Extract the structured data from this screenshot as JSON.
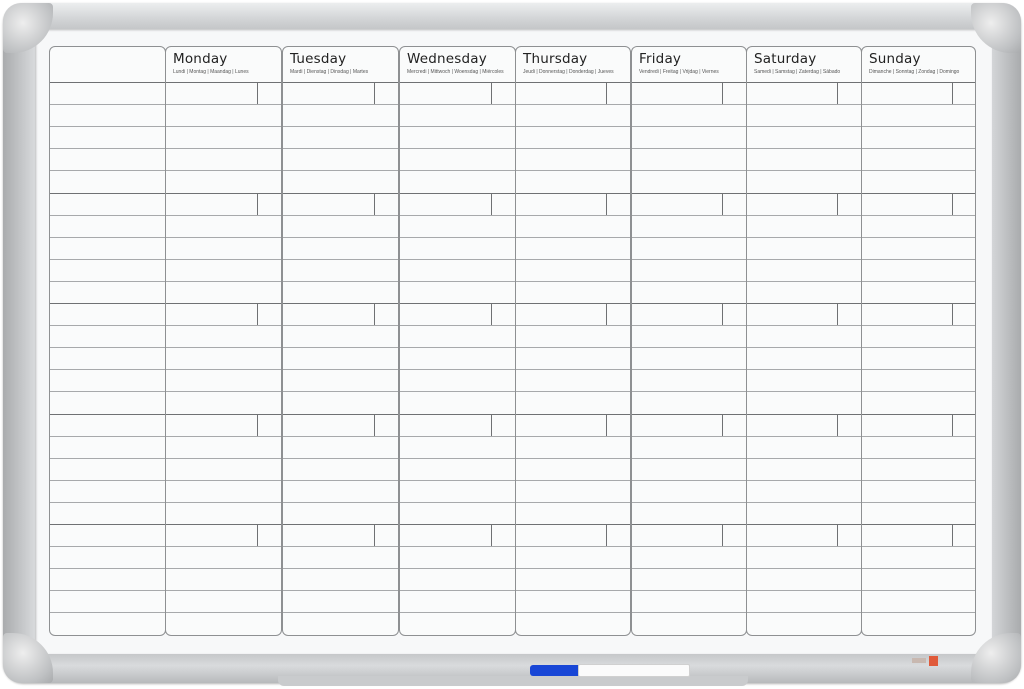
{
  "planner": {
    "days": [
      {
        "name": "Monday",
        "translations": "Lundi | Montag | Maandag | Lunes"
      },
      {
        "name": "Tuesday",
        "translations": "Mardi | Dienstag | Dinsdag | Martes"
      },
      {
        "name": "Wednesday",
        "translations": "Mercredi | Mittwoch | Woensdag | Miércoles"
      },
      {
        "name": "Thursday",
        "translations": "Jeudi | Donnerstag | Donderdag | Jueves"
      },
      {
        "name": "Friday",
        "translations": "Vendredi | Freitag | Vrijdag | Viernes"
      },
      {
        "name": "Saturday",
        "translations": "Samedi | Samstag | Zaterdag | Sábado"
      },
      {
        "name": "Sunday",
        "translations": "Dimanche | Sonntag | Zondag | Domingo"
      }
    ],
    "weeks": 5,
    "lines_per_week": 5
  },
  "colors": {
    "frame": "#c3c5c8",
    "board": "#f7f8f9",
    "grid_major": "#6f7173",
    "grid_minor": "#a7a9ab",
    "marker_cap": "#1846d6",
    "logo": "#e05a3a"
  },
  "objects": {
    "marker_icon": "whiteboard-marker",
    "logo_icon": "brand-logo"
  }
}
